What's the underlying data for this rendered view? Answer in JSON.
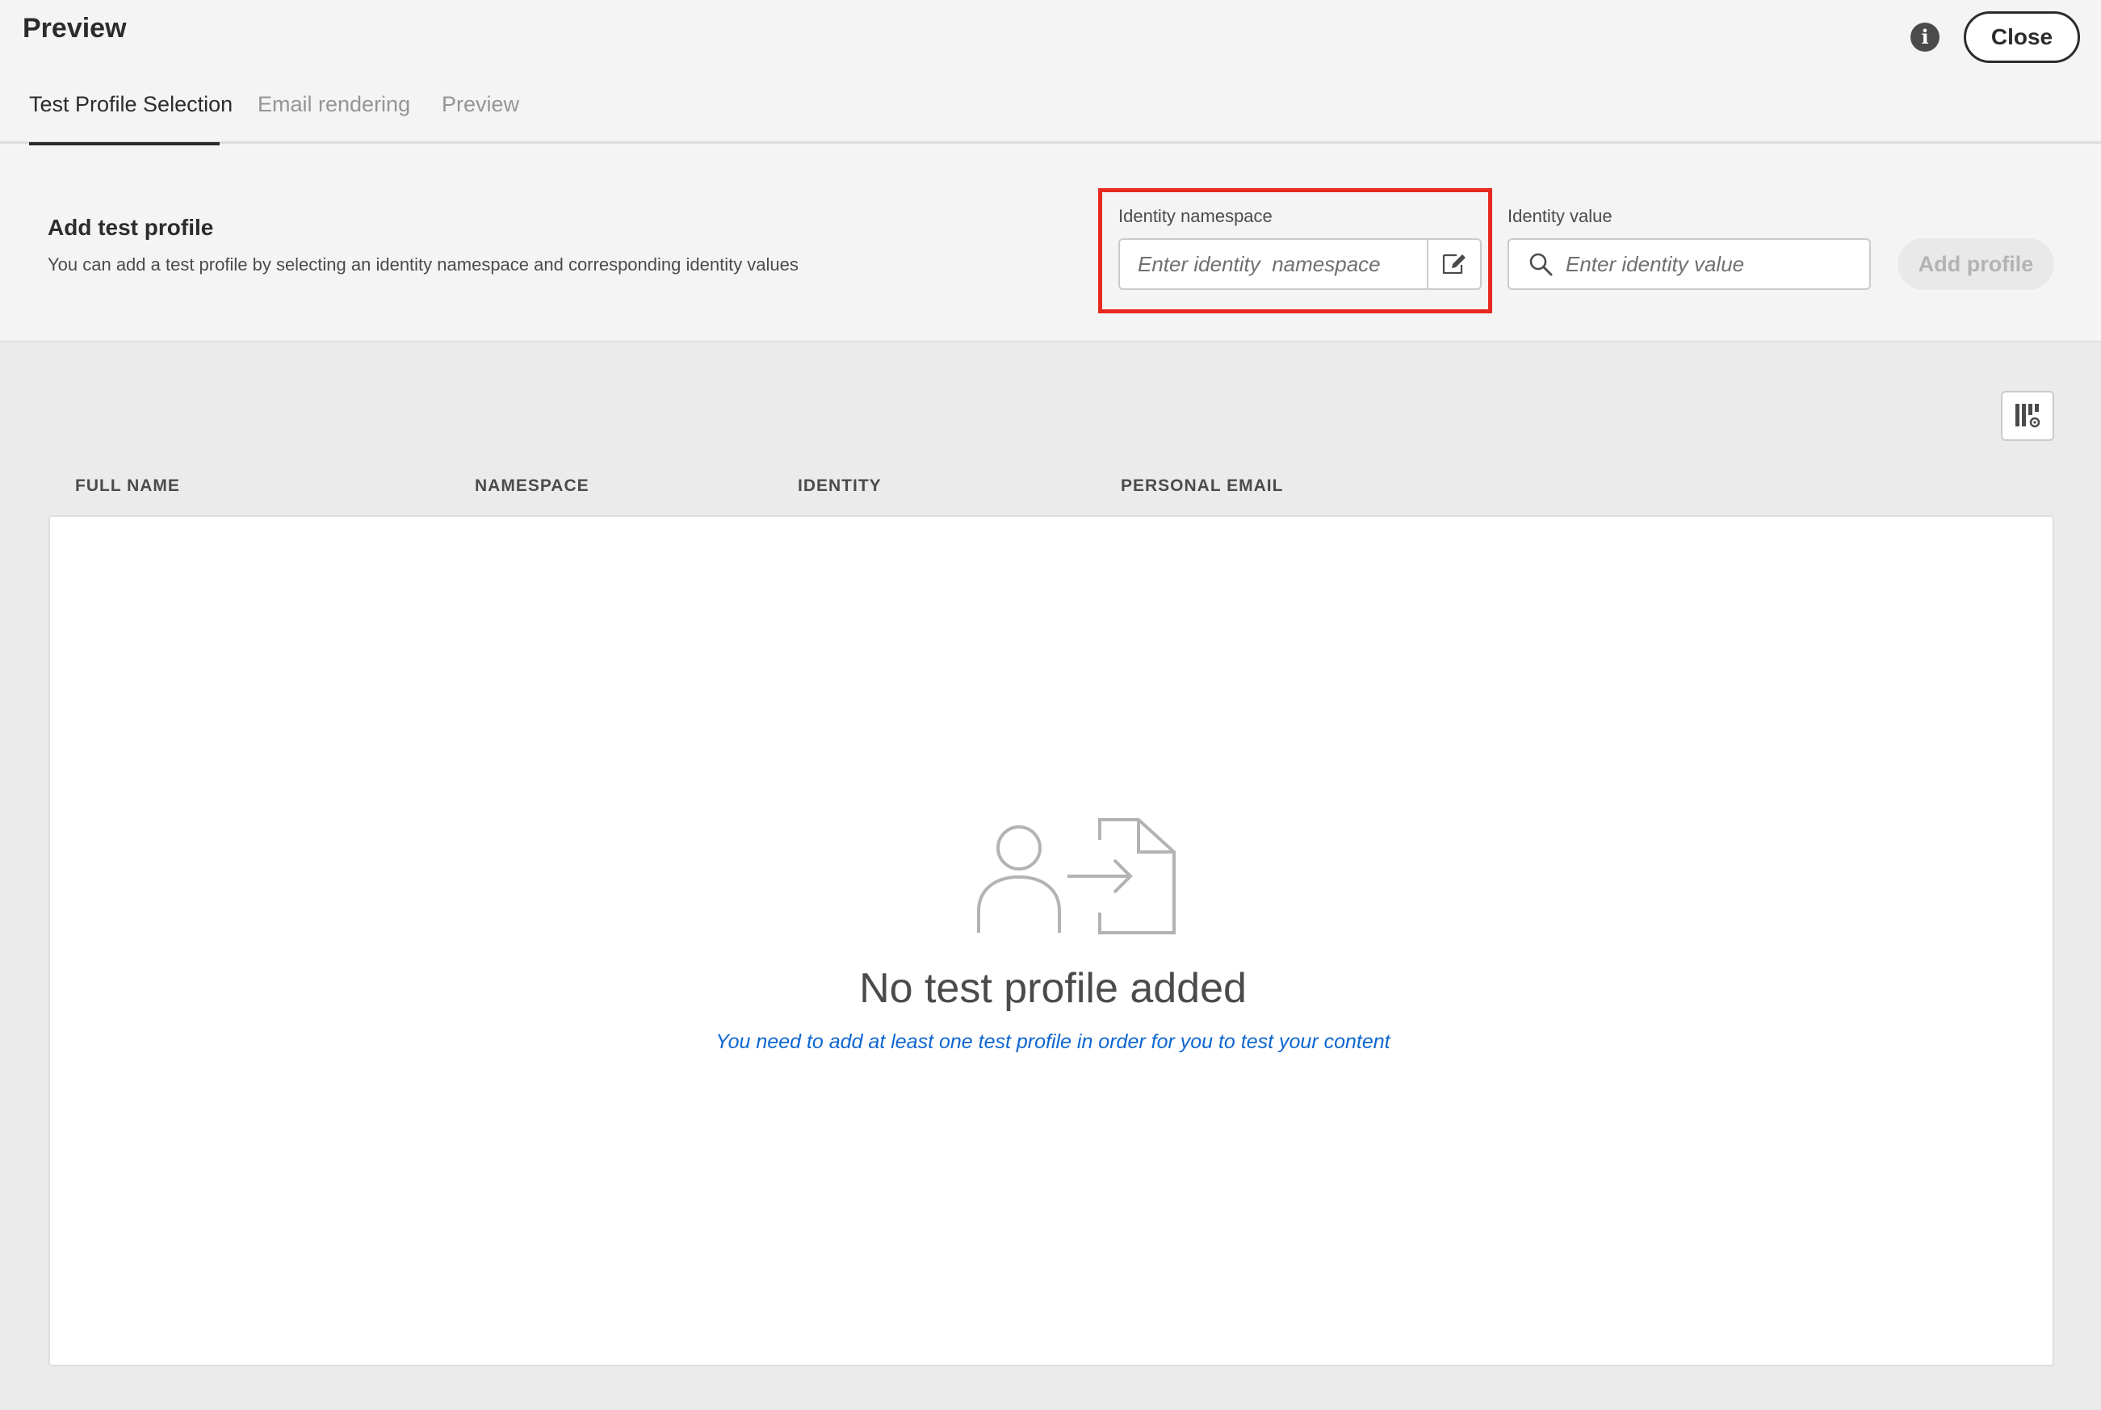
{
  "header": {
    "title": "Preview",
    "close_label": "Close",
    "info_icon": "info-icon",
    "info_glyph": "i"
  },
  "tabs": [
    {
      "label": "Test Profile Selection",
      "active": true
    },
    {
      "label": "Email rendering",
      "active": false
    },
    {
      "label": "Preview",
      "active": false
    }
  ],
  "add_profile": {
    "title": "Add test profile",
    "description": "You can add a test profile by selecting an identity namespace and corresponding identity values",
    "namespace": {
      "label": "Identity namespace",
      "placeholder": "Enter identity  namespace",
      "value": ""
    },
    "identity": {
      "label": "Identity value",
      "placeholder": "Enter identity value",
      "value": ""
    },
    "button_label": "Add profile"
  },
  "table": {
    "columns": [
      "FULL NAME",
      "NAMESPACE",
      "IDENTITY",
      "PERSONAL EMAIL"
    ],
    "rows": [],
    "empty_title": "No test profile added",
    "empty_description": "You need to add at least one test profile in order for you to test your content"
  },
  "colors": {
    "accent_link": "#0d66d0",
    "highlight": "#e8291f",
    "text": "#2c2c2c",
    "muted": "#959595"
  }
}
